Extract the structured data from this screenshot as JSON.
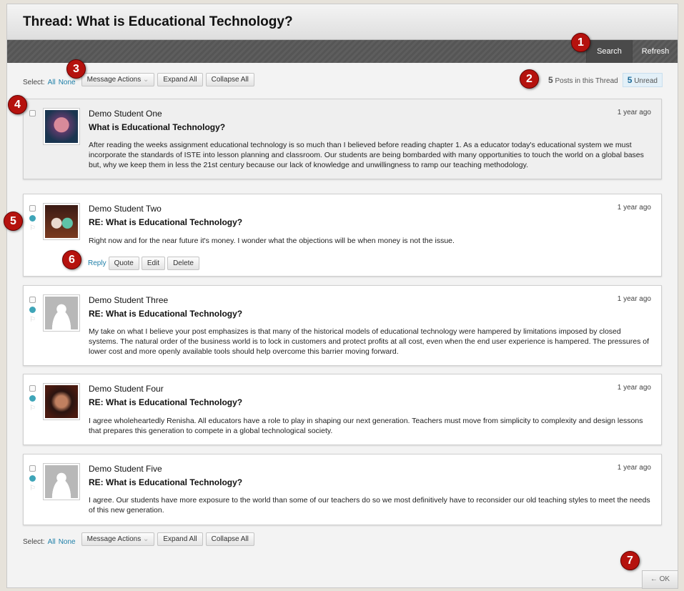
{
  "title": "Thread: What is Educational Technology?",
  "actionbar": {
    "search": "Search",
    "refresh": "Refresh"
  },
  "toolbar": {
    "select_label": "Select:",
    "all": "All",
    "none": "None",
    "message_actions": "Message Actions",
    "expand_all": "Expand All",
    "collapse_all": "Collapse All"
  },
  "stats": {
    "posts_count": "5",
    "posts_label": "Posts in this Thread",
    "unread_count": "5",
    "unread_label": "Unread"
  },
  "post_actions": {
    "reply": "Reply",
    "quote": "Quote",
    "edit": "Edit",
    "delete": "Delete"
  },
  "posts": [
    {
      "author": "Demo Student One",
      "time": "1 year ago",
      "subject": "What is Educational Technology?",
      "body": "After reading the weeks assignment educational technology is so much than I believed before reading chapter 1. As a educator today's educational system we must incorporate the standards  of ISTE into lesson planning and classroom. Our students are being bombarded with many opportunities to touch the world on a global bases but, why we keep them in less the 21st century because our lack of knowledge and unwillingness to ramp our teaching methodology."
    },
    {
      "author": "Demo Student Two",
      "time": "1 year ago",
      "subject": "RE: What is Educational Technology?",
      "body": "Right now and for the near future it's money. I wonder what the objections will be when money is not the issue."
    },
    {
      "author": "Demo Student Three",
      "time": "1 year ago",
      "subject": "RE: What is Educational Technology?",
      "body": "My take on what I believe your post emphasizes is that many of the historical models of educational technology were hampered by limitations imposed by closed systems. The natural order of the business world is to lock in customers and protect profits at all cost, even when the end user experience is hampered. The pressures of lower cost and more openly available tools should help overcome this barrier moving forward."
    },
    {
      "author": "Demo Student Four",
      "time": "1 year ago",
      "subject": "RE: What is Educational Technology?",
      "body": "I agree wholeheartedly Renisha.  All educators have a role to play in shaping our next generation.  Teachers must move from simplicity to complexity and design lessons that prepares this generation to compete in a global technological society."
    },
    {
      "author": "Demo Student Five",
      "time": "1 year ago",
      "subject": "RE: What is Educational Technology?",
      "body": "I agree. Our students have more exposure to the world than some of our teachers do so we most definitively have to reconsider our old teaching styles to meet the needs of this new generation."
    }
  ],
  "markers": [
    "1",
    "2",
    "3",
    "4",
    "5",
    "6",
    "7"
  ],
  "ok": "← OK",
  "colors": {
    "marker": "#b5120e",
    "link": "#1e7fa8",
    "unread_dot": "#3fa5b8"
  }
}
